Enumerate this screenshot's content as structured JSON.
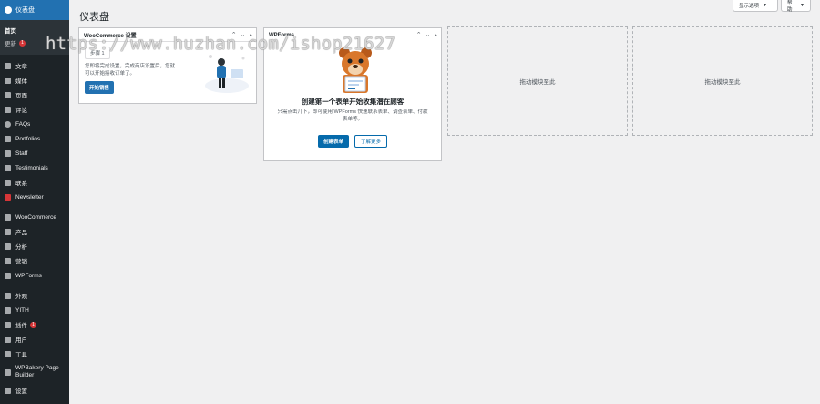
{
  "sidebar": {
    "active_label": "仪表盘",
    "submenu": [
      {
        "label": "首页",
        "badge": ""
      },
      {
        "label": "更新",
        "badge": "1"
      }
    ],
    "items": [
      {
        "label": "文章",
        "icon": "pin-icon"
      },
      {
        "label": "媒体",
        "icon": "media-icon"
      },
      {
        "label": "页面",
        "icon": "page-icon"
      },
      {
        "label": "评论",
        "icon": "comment-icon"
      },
      {
        "label": "FAQs",
        "icon": "faq-icon"
      },
      {
        "label": "Portfolios",
        "icon": "portfolio-icon"
      },
      {
        "label": "Staff",
        "icon": "staff-icon"
      },
      {
        "label": "Testimonials",
        "icon": "testimonial-icon"
      },
      {
        "label": "联系",
        "icon": "mail-icon"
      },
      {
        "label": "Newsletter",
        "icon": "newsletter-icon"
      },
      {
        "label": "WooCommerce",
        "icon": "woocommerce-icon"
      },
      {
        "label": "产品",
        "icon": "product-icon"
      },
      {
        "label": "分析",
        "icon": "analytics-icon"
      },
      {
        "label": "营销",
        "icon": "marketing-icon"
      },
      {
        "label": "WPForms",
        "icon": "wpforms-icon"
      },
      {
        "label": "外观",
        "icon": "appearance-icon"
      },
      {
        "label": "YITH",
        "icon": "yith-icon"
      },
      {
        "label": "插件",
        "icon": "plugin-icon",
        "badge": "1"
      },
      {
        "label": "用户",
        "icon": "user-icon"
      },
      {
        "label": "工具",
        "icon": "tools-icon"
      },
      {
        "label": "WPBakery Page Builder",
        "icon": "wpbakery-icon"
      },
      {
        "label": "设置",
        "icon": "settings-icon"
      }
    ]
  },
  "header": {
    "title": "仪表盘",
    "screen_options": "显示选项",
    "help": "帮助"
  },
  "woocommerce_widget": {
    "title": "WooCommerce 设置",
    "step": "步骤 1",
    "text": "您即将完成设置，完成商店设置后，您就可以开始接收订单了。",
    "button": "开始销售"
  },
  "wpforms_widget": {
    "title": "WPForms",
    "heading": "创建第一个表单开始收集潜在顾客",
    "description": "只需点击几下，即可使用 WPForms 快速联系表单、调查表单、付款表单等。",
    "primary_button": "创建表单",
    "secondary_button": "了解更多"
  },
  "dropzones": [
    "拖动模块至此",
    "拖动模块至此"
  ],
  "watermark": "https://www.huzhan.com/ishop21627",
  "colors": {
    "sidebar_bg": "#1d2327",
    "accent": "#2271b1",
    "badge": "#d63638"
  }
}
